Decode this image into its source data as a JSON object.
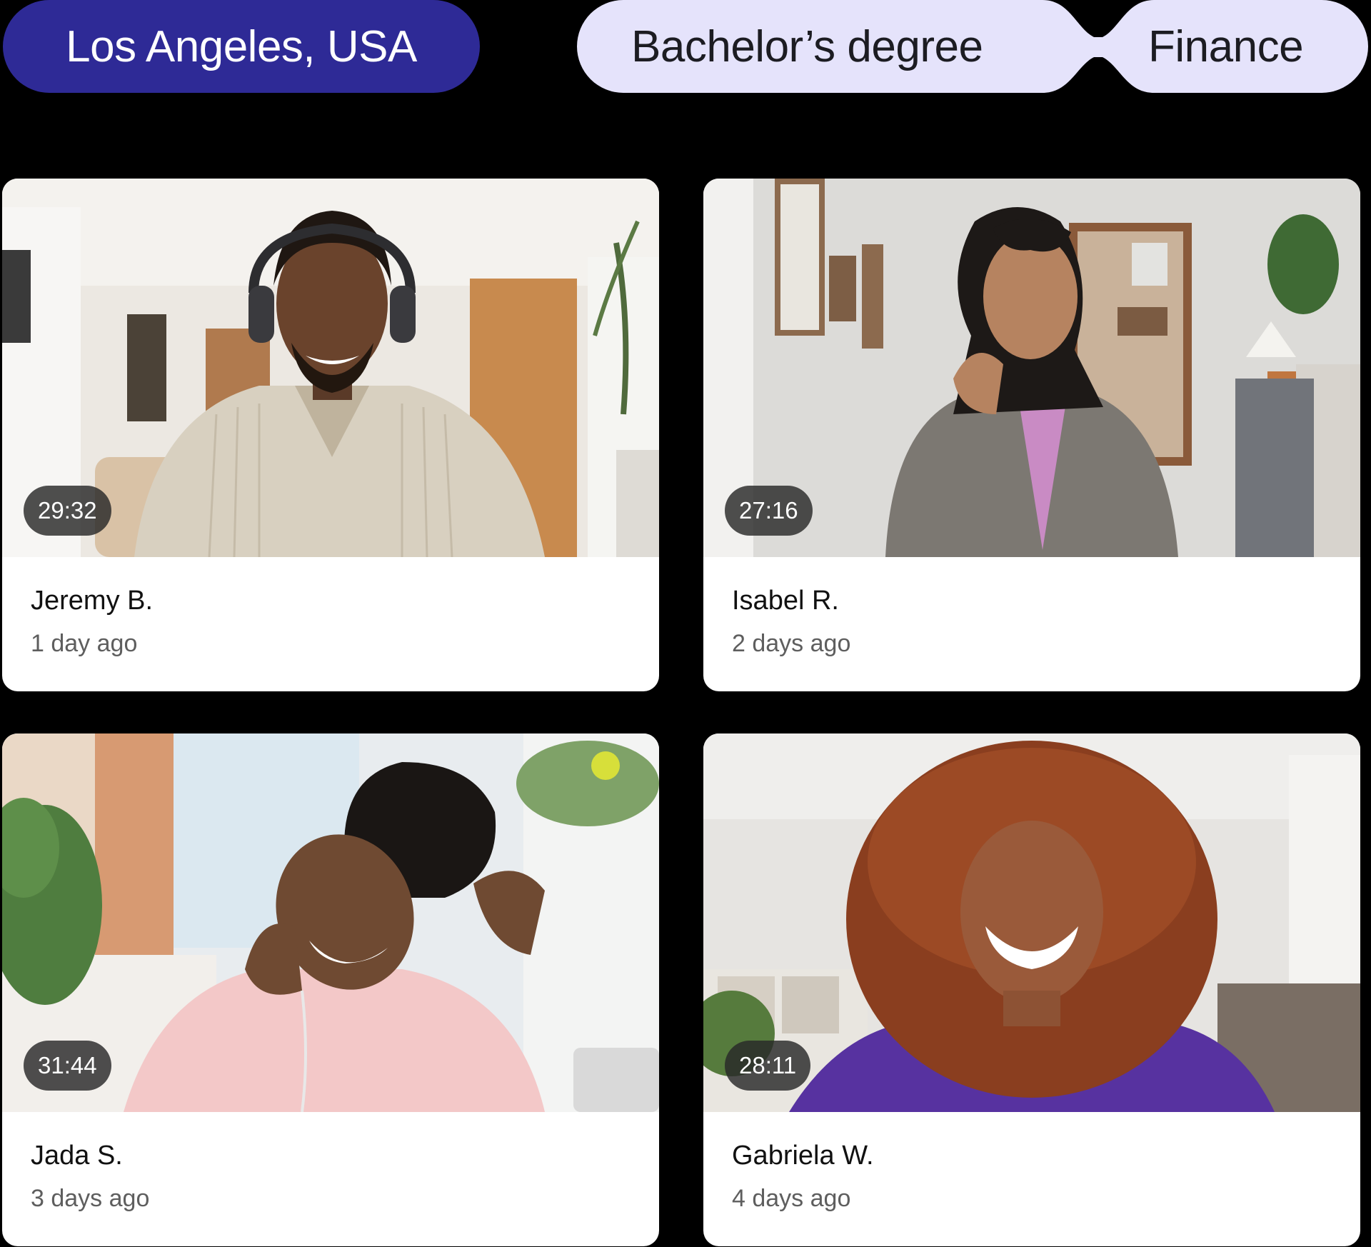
{
  "filters": {
    "location": "Los Angeles, USA",
    "degree": "Bachelor’s degree",
    "field": "Finance"
  },
  "colors": {
    "location_chip": "#2e2a96",
    "linked_chip": "#e5e3fb",
    "background": "#000000",
    "card": "#ffffff"
  },
  "interviews": [
    {
      "name": "Jeremy B.",
      "ago": "1 day ago",
      "duration": "29:32"
    },
    {
      "name": "Isabel R.",
      "ago": "2 days ago",
      "duration": "27:16"
    },
    {
      "name": "Jada S.",
      "ago": "3 days ago",
      "duration": "31:44"
    },
    {
      "name": "Gabriela W.",
      "ago": "4 days ago",
      "duration": "28:11"
    }
  ]
}
